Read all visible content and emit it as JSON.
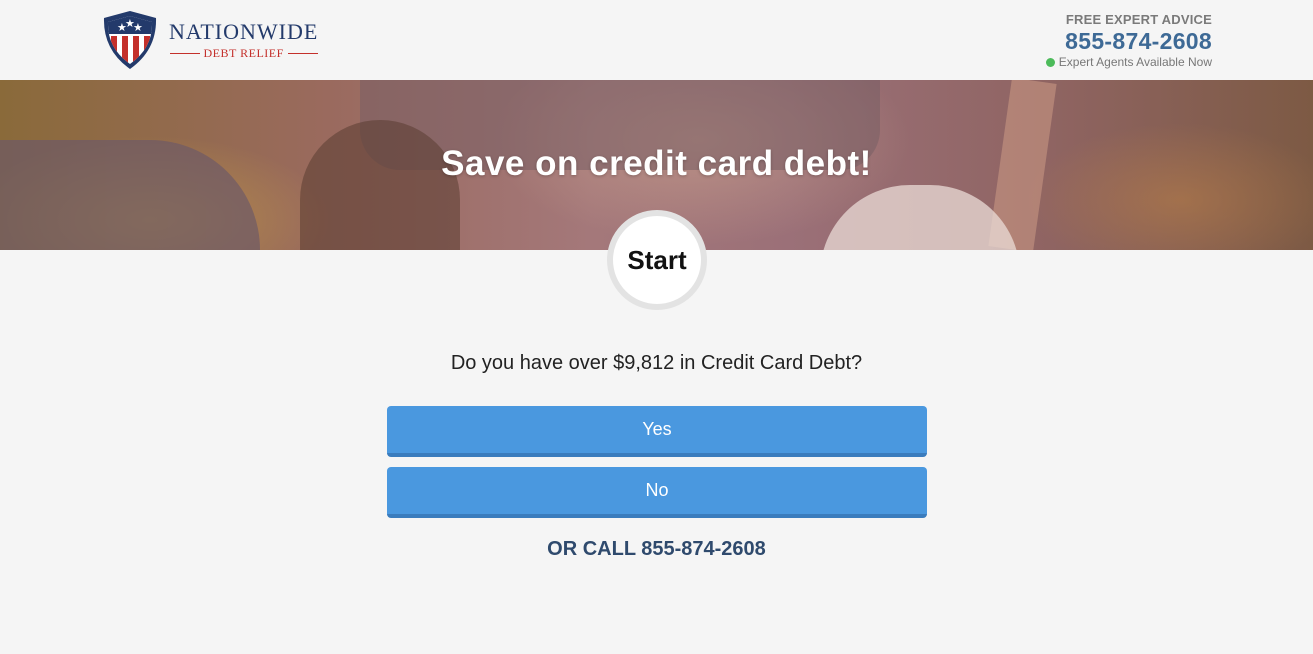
{
  "header": {
    "logo": {
      "name": "NATIONWIDE",
      "sub": "DEBT RELIEF"
    },
    "contact": {
      "kicker": "FREE EXPERT ADVICE",
      "phone": "855-874-2608",
      "status": "Expert Agents Available Now"
    }
  },
  "hero": {
    "title": "Save on credit card debt!"
  },
  "step": {
    "label": "Start"
  },
  "quiz": {
    "question": "Do you have over $9,812 in Credit Card Debt?",
    "answers": [
      {
        "label": "Yes"
      },
      {
        "label": "No"
      }
    ]
  },
  "footer_call": {
    "prefix": "OR CALL",
    "phone": "855-874-2608"
  },
  "colors": {
    "accent_blue": "#4a98df",
    "phone_blue": "#3e6a96",
    "brand_navy": "#233a6b",
    "brand_red": "#c4302b",
    "status_green": "#4cbb5a"
  },
  "icons": {
    "logo_shield": "shield-stars-stripes-icon",
    "status": "online-dot-icon"
  }
}
